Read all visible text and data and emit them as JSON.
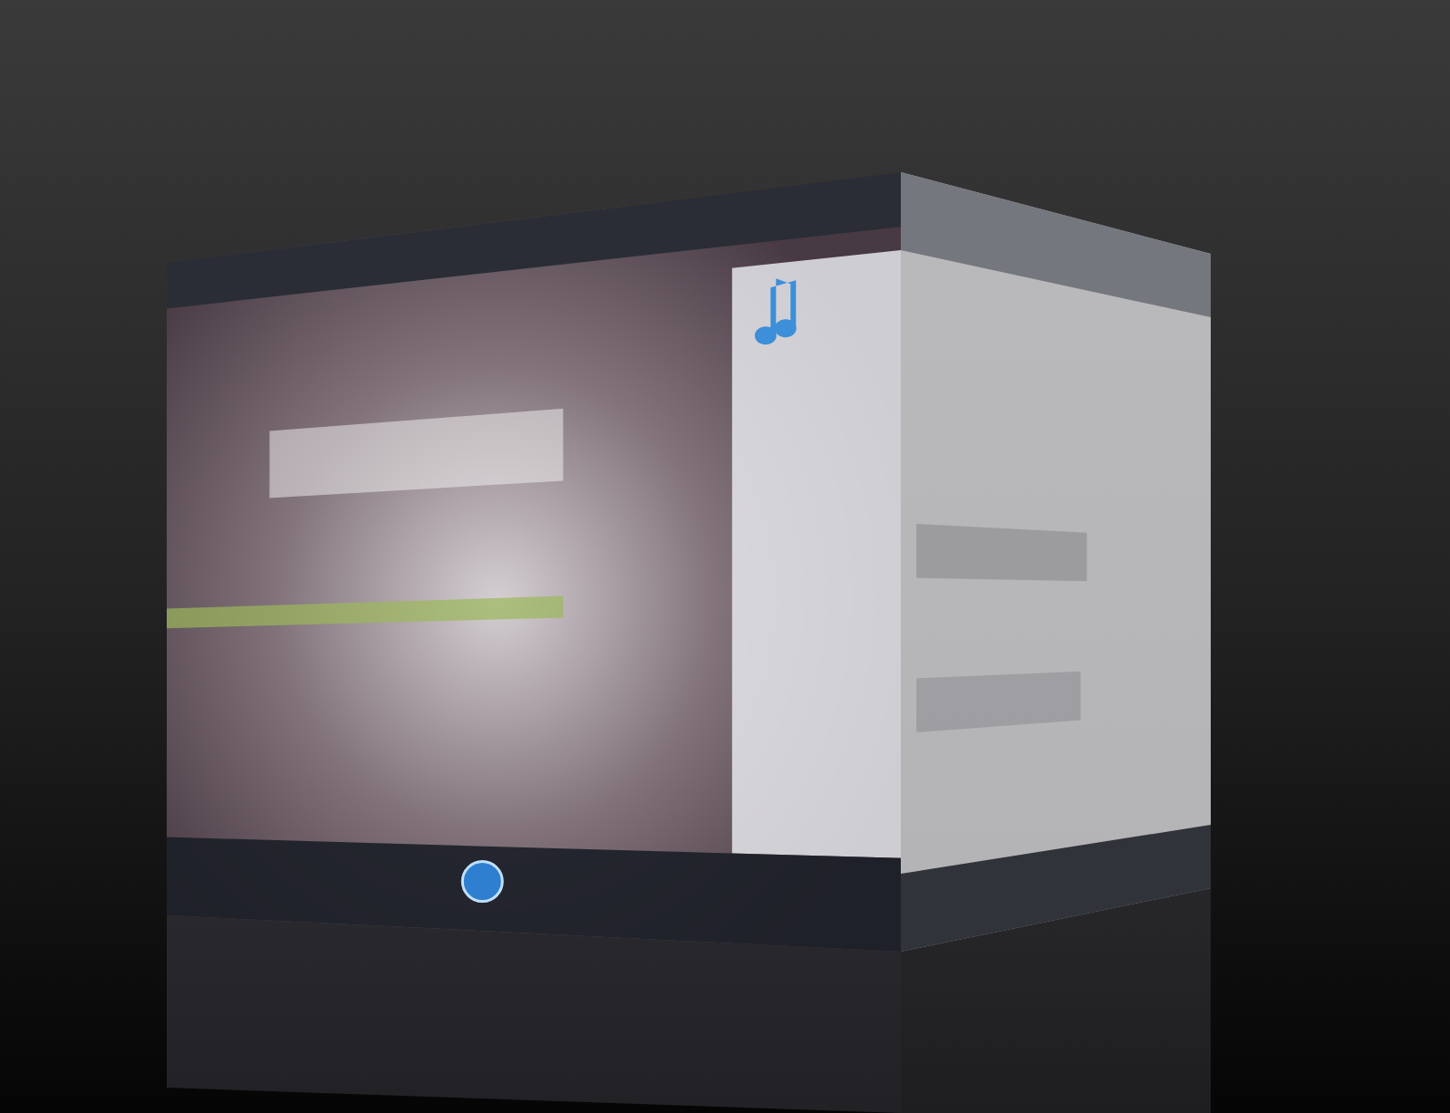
{
  "scene": {
    "kind": "desktop-cube",
    "faces": [
      {
        "kind": "media-player"
      },
      {
        "kind": "web-browser"
      }
    ]
  }
}
